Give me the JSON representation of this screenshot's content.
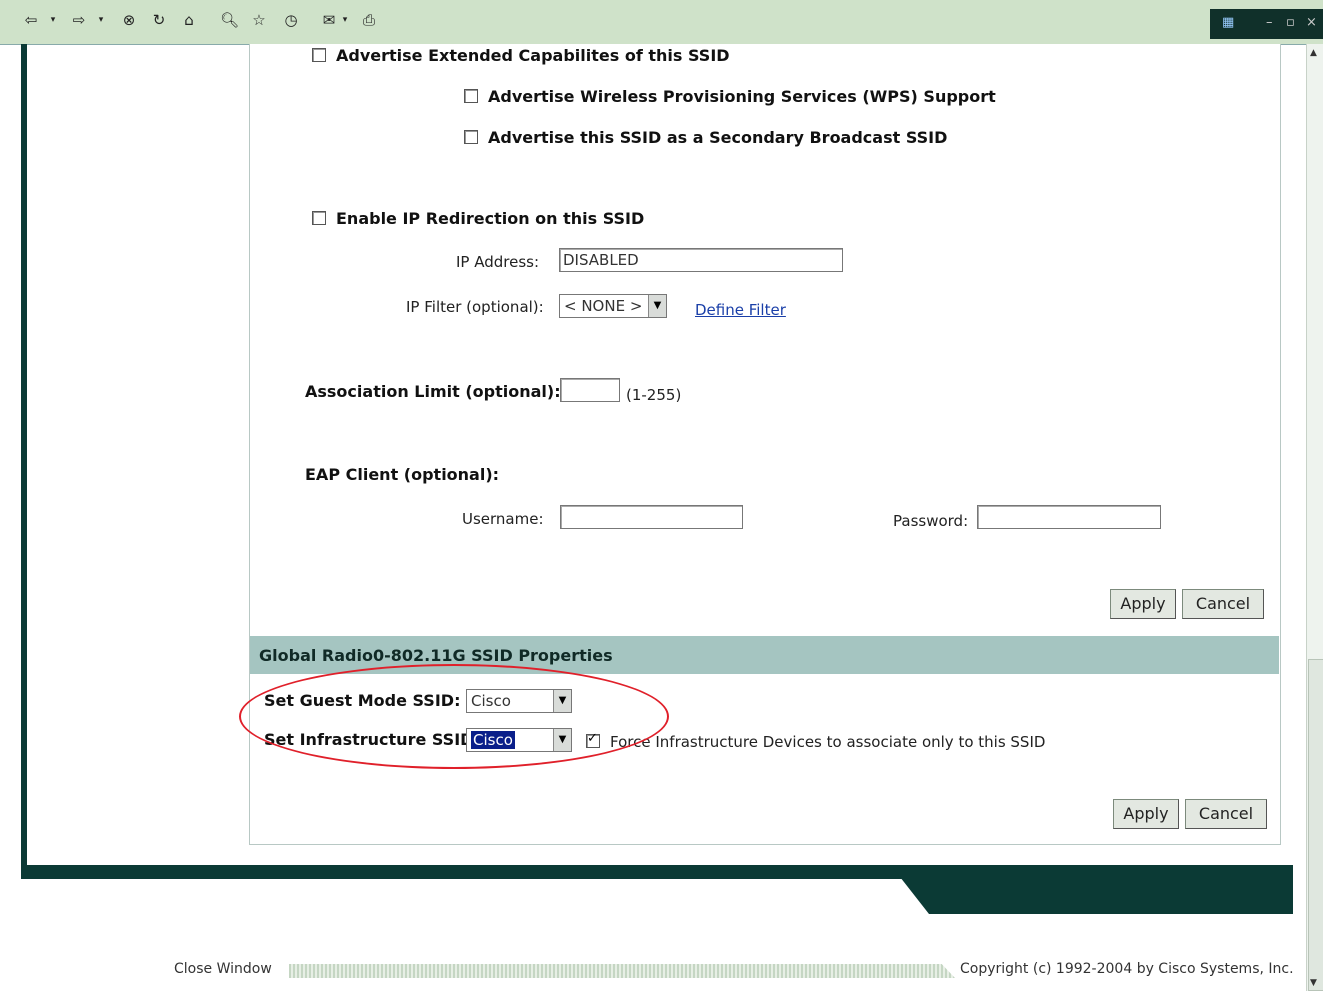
{
  "toolbar": {
    "icons": [
      "back-icon",
      "forward-icon",
      "stop-icon",
      "refresh-icon",
      "home-icon",
      "search-icon",
      "favorites-icon",
      "history-icon",
      "mail-icon",
      "print-icon"
    ]
  },
  "ssid_options": {
    "advertise_extended": {
      "label": "Advertise Extended Capabilites of this SSID",
      "checked": false
    },
    "advertise_wps": {
      "label": "Advertise Wireless Provisioning Services (WPS) Support",
      "checked": false
    },
    "advertise_secondary": {
      "label": "Advertise this SSID as a Secondary Broadcast SSID",
      "checked": false
    },
    "enable_ip_redirection": {
      "label": "Enable IP Redirection on this SSID",
      "checked": false
    }
  },
  "ip_redirection": {
    "ip_address_label": "IP Address:",
    "ip_address_value": "DISABLED",
    "ip_filter_label": "IP Filter (optional):",
    "ip_filter_value": "< NONE >",
    "define_filter_link": "Define Filter"
  },
  "association_limit": {
    "label": "Association Limit (optional):",
    "value": "",
    "range": "(1-255)"
  },
  "eap_client": {
    "heading": "EAP Client (optional):",
    "username_label": "Username:",
    "username_value": "",
    "password_label": "Password:",
    "password_value": ""
  },
  "buttons": {
    "apply": "Apply",
    "cancel": "Cancel"
  },
  "global_section": {
    "title": "Global Radio0-802.11G SSID Properties",
    "guest_mode_label": "Set Guest Mode SSID:",
    "guest_mode_value": "Cisco",
    "infrastructure_label": "Set Infrastructure SSID:",
    "infrastructure_value": "Cisco",
    "force_infrastructure_label": "Force Infrastructure Devices to associate only to this SSID",
    "force_infrastructure_checked": true
  },
  "footer": {
    "close_window": "Close Window",
    "copyright": "Copyright (c) 1992-2004 by Cisco Systems, Inc."
  },
  "colors": {
    "toolbar_bg": "#cfe2c9",
    "frame_dark": "#0b3a35",
    "section_bar": "#a5c5c1",
    "highlight_ellipse": "#e0202a",
    "link": "#1a3fa8"
  }
}
